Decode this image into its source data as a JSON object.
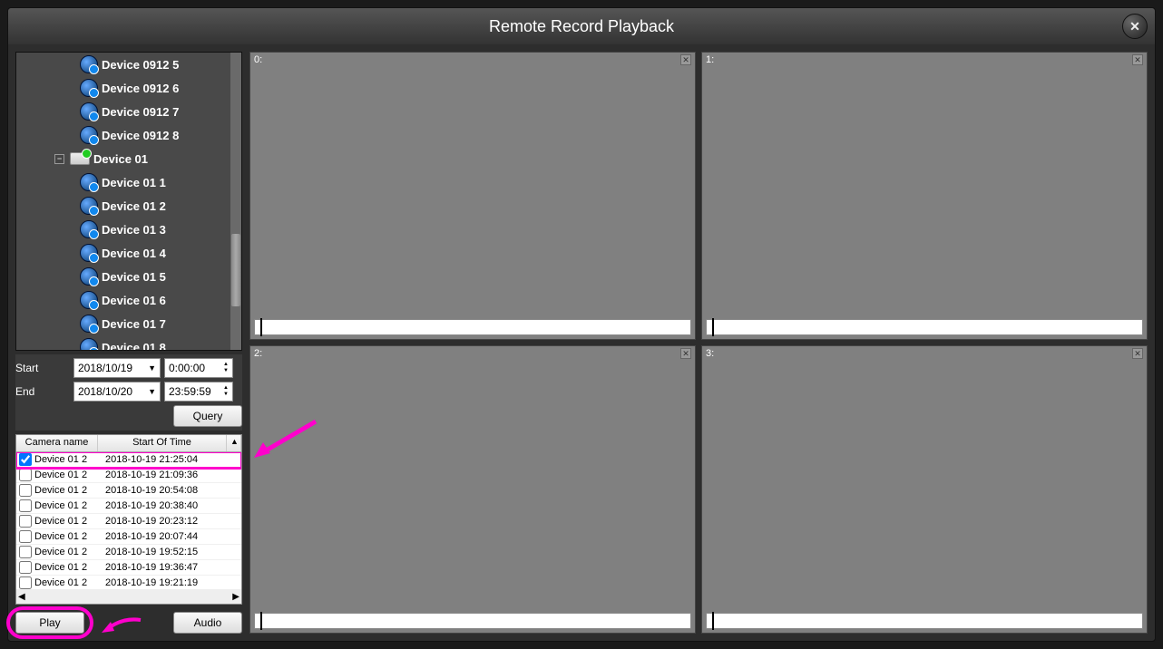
{
  "title": "Remote Record Playback",
  "tree": {
    "top_items": [
      "Device 0912 5",
      "Device 0912 6",
      "Device 0912 7",
      "Device 0912 8"
    ],
    "parent": "Device 01",
    "children": [
      "Device 01 1",
      "Device 01 2",
      "Device 01 3",
      "Device 01 4",
      "Device 01 5",
      "Device 01 6",
      "Device 01 7",
      "Device 01 8"
    ]
  },
  "filter": {
    "start_label": "Start",
    "end_label": "End",
    "start_date": "2018/10/19",
    "start_time": "0:00:00",
    "end_date": "2018/10/20",
    "end_time": "23:59:59",
    "query": "Query"
  },
  "results": {
    "col_camera": "Camera name",
    "col_time": "Start Of Time",
    "rows": [
      {
        "cam": "Device 01 2",
        "time": "2018-10-19 21:25:04",
        "checked": true,
        "hl": true
      },
      {
        "cam": "Device 01 2",
        "time": "2018-10-19 21:09:36"
      },
      {
        "cam": "Device 01 2",
        "time": "2018-10-19 20:54:08"
      },
      {
        "cam": "Device 01 2",
        "time": "2018-10-19 20:38:40"
      },
      {
        "cam": "Device 01 2",
        "time": "2018-10-19 20:23:12"
      },
      {
        "cam": "Device 01 2",
        "time": "2018-10-19 20:07:44"
      },
      {
        "cam": "Device 01 2",
        "time": "2018-10-19 19:52:15"
      },
      {
        "cam": "Device 01 2",
        "time": "2018-10-19 19:36:47"
      },
      {
        "cam": "Device 01 2",
        "time": "2018-10-19 19:21:19"
      }
    ]
  },
  "buttons": {
    "play": "Play",
    "audio": "Audio"
  },
  "cells": [
    "0:",
    "1:",
    "2:",
    "3:"
  ]
}
